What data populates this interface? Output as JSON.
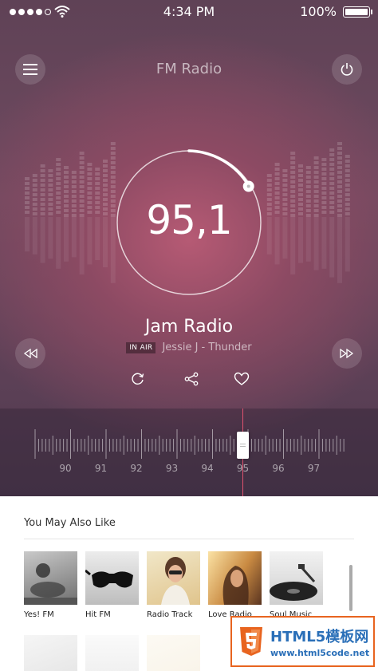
{
  "status_bar": {
    "time": "4:34 PM",
    "battery": "100%"
  },
  "header": {
    "title": "FM Radio"
  },
  "player": {
    "frequency": "95,1",
    "station": "Jam Radio",
    "badge": "IN AIR",
    "track": "Jessie J - Thunder"
  },
  "tuner": {
    "labels": [
      "90",
      "91",
      "92",
      "93",
      "94",
      "95",
      "96",
      "97"
    ],
    "value": 95.1
  },
  "suggestions": {
    "title": "You May Also Like",
    "items": [
      {
        "label": "Yes! FM"
      },
      {
        "label": "Hit FM"
      },
      {
        "label": "Radio Track"
      },
      {
        "label": "Love Radio"
      },
      {
        "label": "Soul Music"
      }
    ]
  },
  "watermark": {
    "brand": "HTML5模板网",
    "url": "www.html5code.net"
  },
  "colors": {
    "accent": "#e0526f",
    "brand_blue": "#2a6fb8",
    "watermark_orange": "#e8641f"
  }
}
